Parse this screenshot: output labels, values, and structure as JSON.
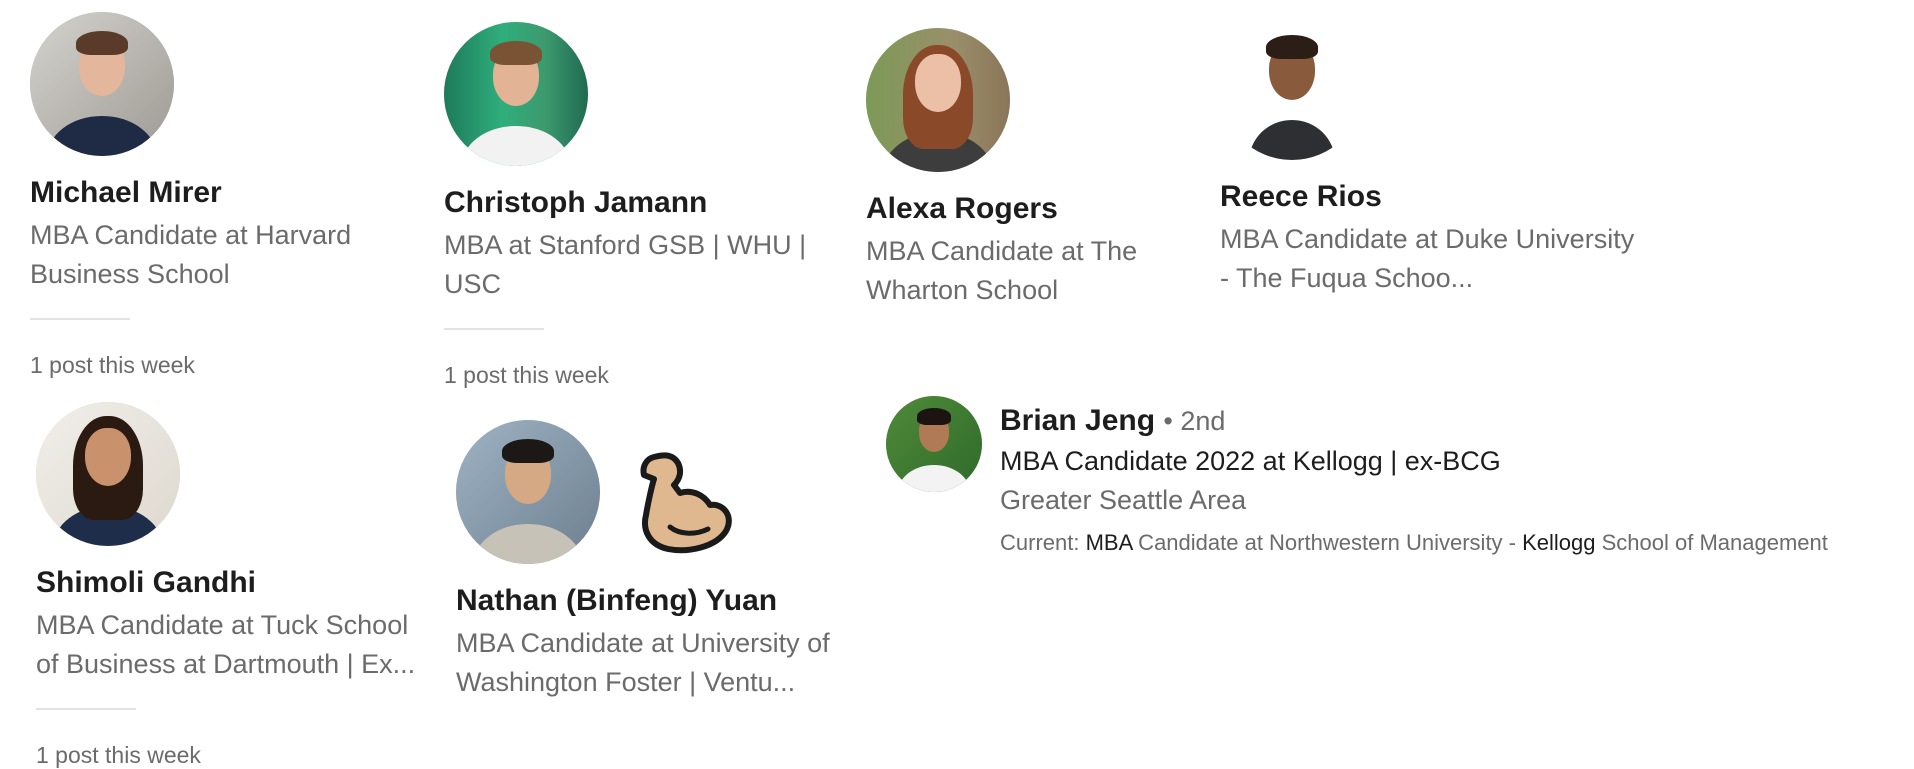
{
  "people": [
    {
      "name": "Michael Mirer",
      "headline": "MBA Candidate at Harvard Business School",
      "posts": "1 post this week"
    },
    {
      "name": "Christoph Jamann",
      "headline": "MBA at Stanford GSB | WHU | USC",
      "posts": "1 post this week"
    },
    {
      "name": "Alexa Rogers",
      "headline": "MBA Candidate at The Wharton School"
    },
    {
      "name": "Reece Rios",
      "headline": "MBA Candidate at Duke University - The Fuqua Schoo..."
    },
    {
      "name": "Shimoli Gandhi",
      "headline": "MBA Candidate at Tuck School of Business at Dartmouth | Ex...",
      "posts": "1 post this week"
    },
    {
      "name": "Nathan (Binfeng) Yuan",
      "headline": "MBA Candidate at University of Washington Foster | Ventu...",
      "emoji": "flexed-biceps-icon"
    }
  ],
  "search_result": {
    "name": "Brian Jeng",
    "degree": "• 2nd",
    "headline": "MBA Candidate 2022 at Kellogg | ex-BCG",
    "location": "Greater Seattle Area",
    "current": {
      "prefix": "Current: ",
      "highlight1": "MBA",
      "middle": " Candidate at Northwestern University - ",
      "highlight2": "Kellogg",
      "suffix": " School of Management"
    }
  }
}
